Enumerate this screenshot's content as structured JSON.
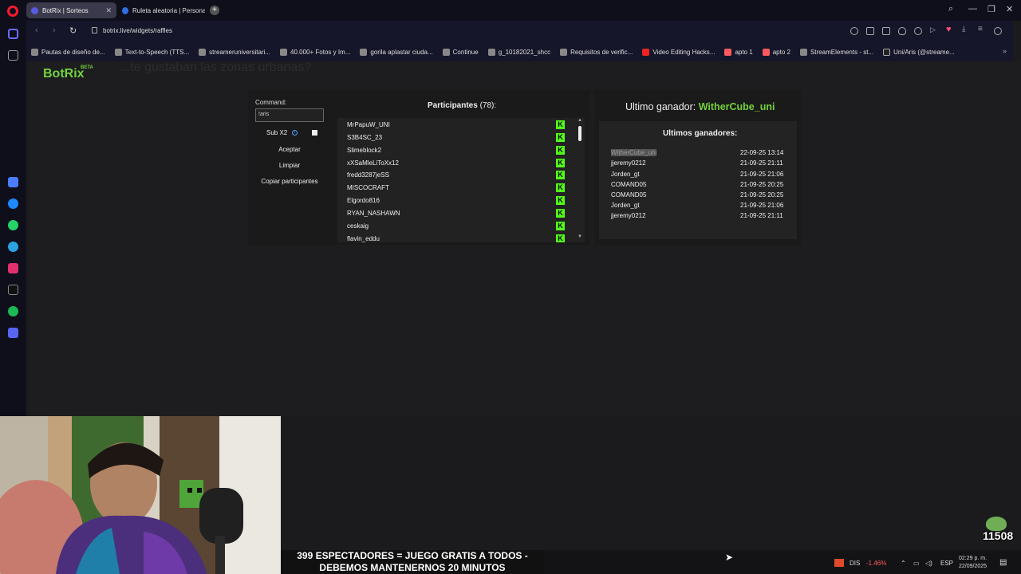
{
  "browser": {
    "tabs": [
      {
        "label": "BotRix | Sorteos",
        "active": true
      },
      {
        "label": "Ruleta aleatoria | Personali...",
        "active": false
      }
    ],
    "url": "botrix.live/widgets/raffles",
    "bookmarks": [
      "Pautas de diseño de...",
      "Text-to-Speech (TTS...",
      "streameruniversitari...",
      "40.000+ Fotos y Im...",
      "gorila aplastar ciuda...",
      "Continue",
      "g_10182021_shcc",
      "Requisitos de verific...",
      "Video Editing Hacks...",
      "apto 1",
      "apto 2",
      "StreamElements - st...",
      "Uni/Aris (@streame..."
    ]
  },
  "app": {
    "logo": "BotRix",
    "beta": "BETA",
    "ghost_text": "...te gustaban las zonas urbanas?"
  },
  "raffle": {
    "command_label": "Command:",
    "command_value": "!aris",
    "sub_label": "Sub X2",
    "accept_label": "Aceptar",
    "clear_label": "Limpiar",
    "copy_label": "Copiar participantes",
    "participants_title": "Participantes",
    "participants_count": "(78):",
    "participants": [
      "MrPapuW_UNI",
      "S3B4SC_23",
      "Slimeblock2",
      "xXSaMleLiToXx12",
      "fredd3287jeSS",
      "MISCOCRAFT",
      "Elgordo816",
      "RYAN_NASHAWN",
      "ceskaig",
      "flavin_eddu"
    ],
    "kick_glyph": "K"
  },
  "winners": {
    "last_winner_label": "Ultimo ganador:",
    "last_winner_name": "WitherCube_uni",
    "recent_title": "Ultimos ganadores:",
    "list": [
      {
        "name": "WitherCube_uni",
        "date": "22-09-25 13:14"
      },
      {
        "name": "jjeremy0212",
        "date": "21-09-25 21:11"
      },
      {
        "name": "Jorden_gt",
        "date": "21-09-25 21:06"
      },
      {
        "name": "COMAND05",
        "date": "21-09-25 20:25"
      },
      {
        "name": "COMAND05",
        "date": "21-09-25 20:25"
      },
      {
        "name": "Jorden_gt",
        "date": "21-09-25 21:06"
      },
      {
        "name": "jjeremy0212",
        "date": "21-09-25 21:11"
      }
    ]
  },
  "stream": {
    "overlay_line1": "399 ESPECTADORES = JUEGO GRATIS A TODOS -",
    "overlay_line2": "DEBEMOS MANTENERNOS 20 MINUTOS",
    "counter": "11508"
  },
  "taskbar": {
    "ticker": "DIS",
    "ticker_change": "-1.46%",
    "lang": "ESP",
    "time": "02:29 p. m.",
    "date": "22/09/2025"
  },
  "colors": {
    "accent": "#73d13d",
    "kick": "#53fc18",
    "negative": "#ff5c5c"
  }
}
